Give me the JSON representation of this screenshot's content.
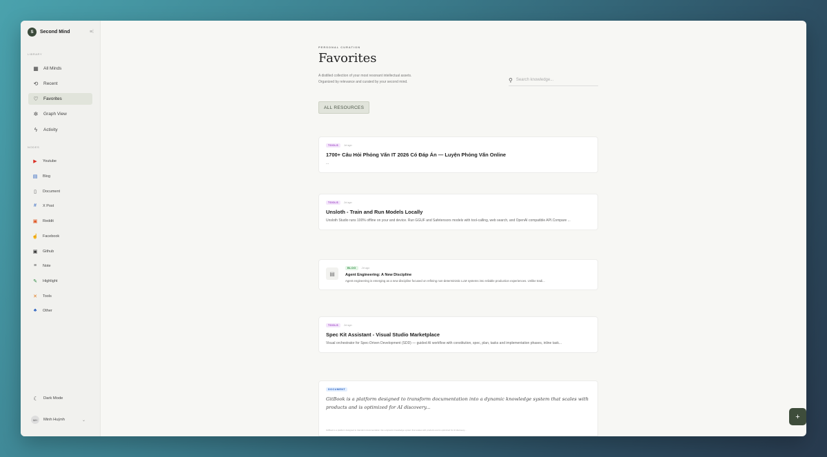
{
  "brand": {
    "logo_letter": "S",
    "name": "Second Mind",
    "collapse_icon": "sidebar-collapse-icon"
  },
  "sidebar": {
    "library_label": "LIBRARY",
    "library_items": [
      {
        "label": "All Minds",
        "icon": "grid-icon",
        "glyph": "▦"
      },
      {
        "label": "Recent",
        "icon": "history-icon",
        "glyph": "⟲"
      },
      {
        "label": "Favorites",
        "icon": "heart-icon",
        "glyph": "♡"
      },
      {
        "label": "Graph View",
        "icon": "graph-icon",
        "glyph": "✲"
      },
      {
        "label": "Activity",
        "icon": "bolt-icon",
        "glyph": "ϟ"
      }
    ],
    "nodes_label": "NODES",
    "source_items": [
      {
        "label": "Youtube",
        "icon": "youtube-icon",
        "glyph": "▶",
        "color": "#d93025"
      },
      {
        "label": "Blog",
        "icon": "blog-icon",
        "glyph": "▤",
        "color": "#2b62c0"
      },
      {
        "label": "Document",
        "icon": "document-icon",
        "glyph": "▯",
        "color": "#555555"
      },
      {
        "label": "X Post",
        "icon": "hash-icon",
        "glyph": "#",
        "color": "#2b62c0"
      },
      {
        "label": "Reddit",
        "icon": "reddit-icon",
        "glyph": "▣",
        "color": "#e0531f"
      },
      {
        "label": "Facebook",
        "icon": "thumbs-up-icon",
        "glyph": "👍",
        "color": "#2b62c0"
      },
      {
        "label": "Github",
        "icon": "github-icon",
        "glyph": "▣",
        "color": "#333333"
      },
      {
        "label": "Note",
        "icon": "note-icon",
        "glyph": "≡",
        "color": "#555555"
      },
      {
        "label": "Highlight",
        "icon": "highlighter-icon",
        "glyph": "✎",
        "color": "#2b8a3f"
      },
      {
        "label": "Tools",
        "icon": "tools-icon",
        "glyph": "✕",
        "color": "#e07a1f"
      },
      {
        "label": "Other",
        "icon": "shapes-icon",
        "glyph": "♣",
        "color": "#2b62c0"
      }
    ],
    "dark_mode_label": "Dark Mode",
    "user": {
      "initials": "MH",
      "name": "Minh Huỳnh"
    }
  },
  "main": {
    "eyebrow": "PERSONAL CURATION",
    "title": "Favorites",
    "description_line1": "A distilled collection of your most resonant intellectual assets.",
    "description_line2": "Organized by relevance and curated by your second mind.",
    "search_placeholder": "Search knowledge...",
    "filter_label": "ALL RESOURCES"
  },
  "cards": [
    {
      "badge": "TOOLS",
      "time": "1d ago",
      "title": "1700+ Câu Hỏi Phỏng Vấn IT 2026 Có Đáp Án — Luyện Phỏng Vấn Online",
      "desc": "..."
    },
    {
      "badge": "TOOLS",
      "time": "2d ago",
      "title": "Unsloth - Train and Run Models Locally",
      "desc": "Unsloth Studio runs 100% offline on your and device. Run GGUF and Safetensors models with tool-calling, web search, and OpenAI compatible API.Compare ..."
    },
    {
      "badge": "BLOG",
      "time": "2d ago",
      "title": "Agent Engineering: A New Discipline",
      "desc": "Agent engineering is emerging as a new discipline focused on refining non-deterministic LLM systems into reliable production experiences. Unlike tradi..."
    },
    {
      "badge": "TOOLS",
      "time": "2d ago",
      "title": "Spec Kit Assistant - Visual Studio Marketplace",
      "desc": "Visual orchestrator for Spec-Driven Development (SDD) — guided AI workflow with constitution, spec, plan, tasks and implementation phases, inline task..."
    },
    {
      "badge": "DOCUMENT",
      "title": "GitBook is a platform designed to transform documentation into a dynamic knowledge system that scales with products and is optimized for AI discovery...",
      "note": "GitBook is a platform designed to transform documentation into a dynamic knowledge system that scales with products and is optimized for AI discovery..."
    }
  ],
  "fab_label": "+"
}
